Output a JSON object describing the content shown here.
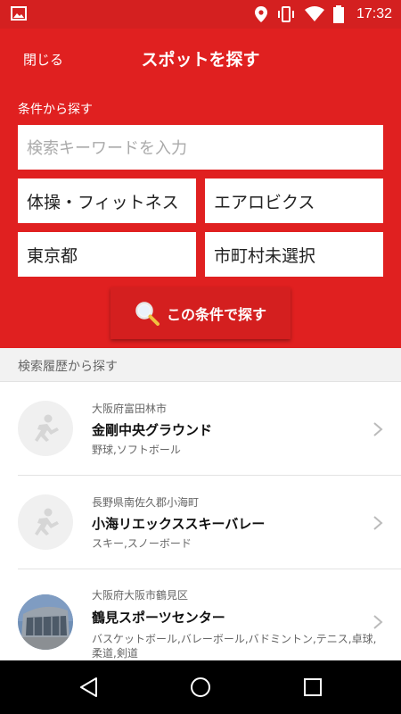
{
  "status_bar": {
    "time": "17:32",
    "icons": [
      "image-icon",
      "location-icon",
      "vibrate-icon",
      "wifi-icon",
      "battery-icon"
    ]
  },
  "header": {
    "close_label": "閉じる",
    "title": "スポットを探す",
    "background_color": "#e02020"
  },
  "search": {
    "section_label": "条件から探す",
    "keyword_placeholder": "検索キーワードを入力",
    "category": "体操・フィットネス",
    "subcategory": "エアロビクス",
    "prefecture": "東京都",
    "city": "市町村未選択",
    "button_label": "この条件で探す"
  },
  "history": {
    "section_label": "検索履歴から探す",
    "items": [
      {
        "area": "大阪府富田林市",
        "name": "金剛中央グラウンド",
        "tags": "野球,ソフトボール",
        "avatar": "athlete-icon"
      },
      {
        "area": "長野県南佐久郡小海町",
        "name": "小海リエックススキーバレー",
        "tags": "スキー,スノーボード",
        "avatar": "athlete-icon"
      },
      {
        "area": "大阪府大阪市鶴見区",
        "name": "鶴見スポーツセンター",
        "tags": "バスケットボール,バレーボール,バドミントン,テニス,卓球,柔道,剣道",
        "avatar": "building-photo"
      }
    ]
  },
  "nav": {
    "buttons": [
      "back-icon",
      "home-icon",
      "recents-icon"
    ]
  }
}
